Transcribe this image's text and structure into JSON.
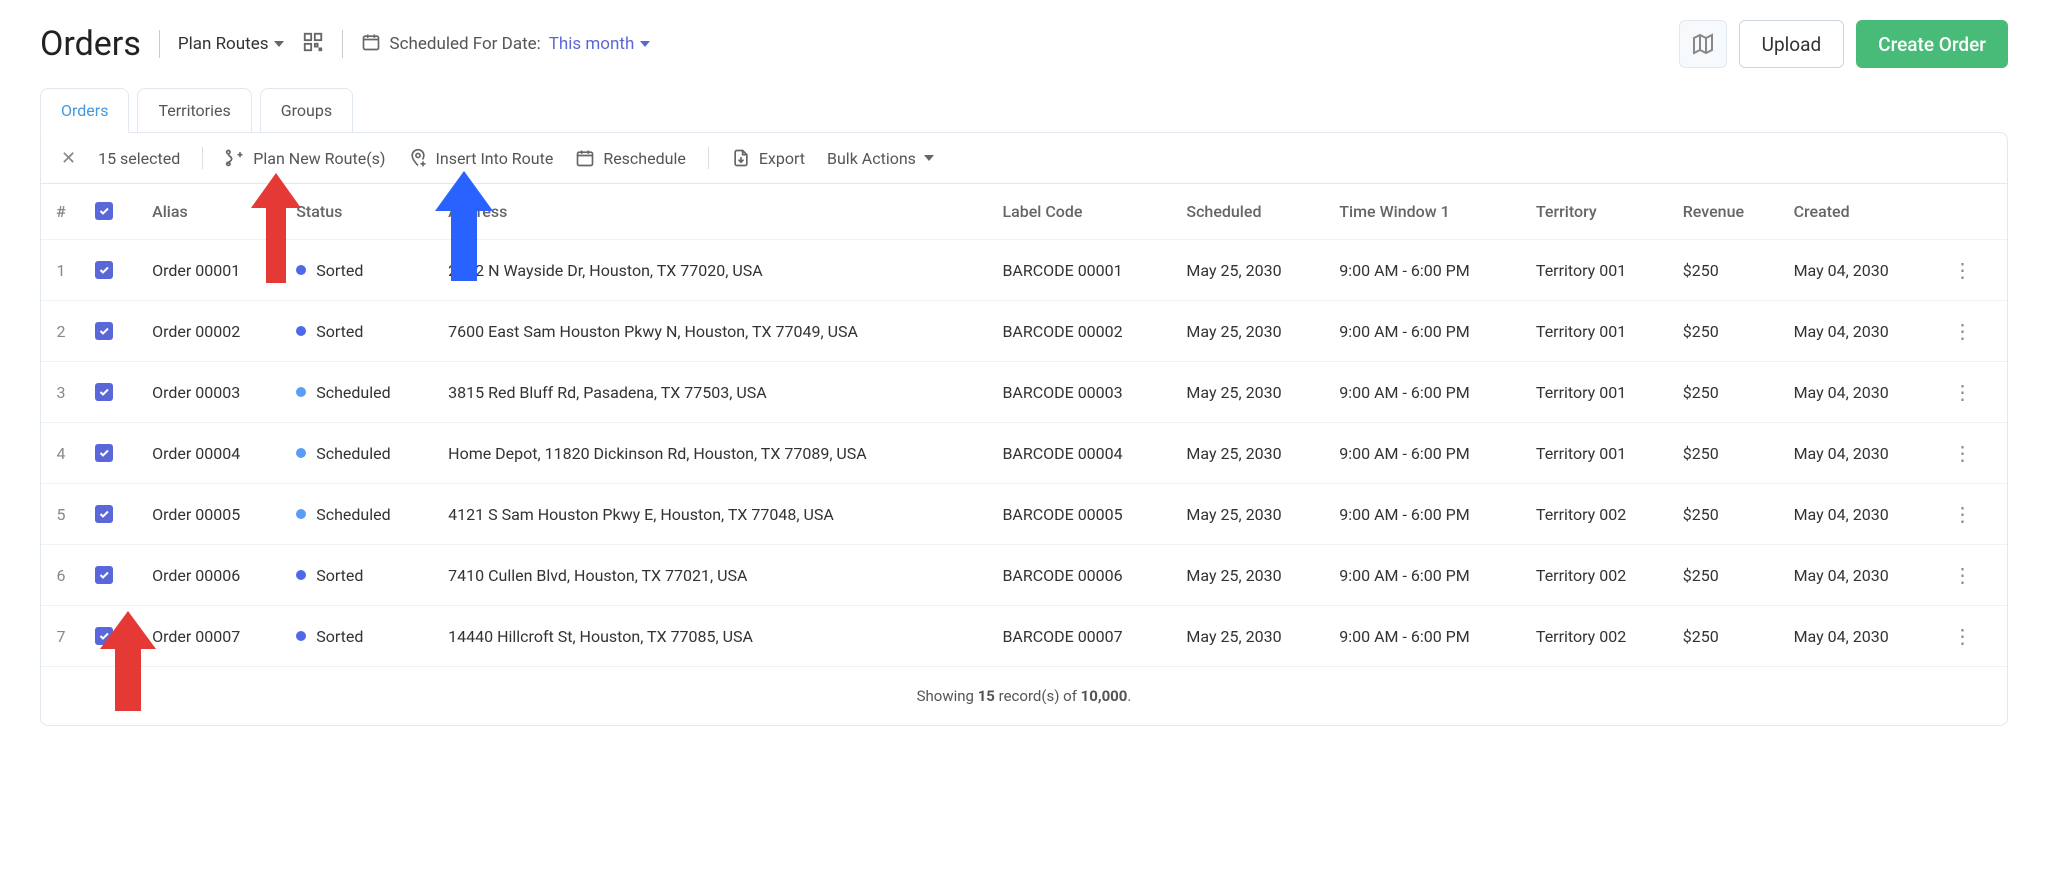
{
  "page_title": "Orders",
  "plan_routes_label": "Plan Routes",
  "scheduled_for_label": "Scheduled For Date:",
  "scheduled_for_value": "This month",
  "upload_label": "Upload",
  "create_order_label": "Create Order",
  "tabs": {
    "orders": "Orders",
    "territories": "Territories",
    "groups": "Groups"
  },
  "selection_count": "15 selected",
  "toolbar": {
    "plan_new": "Plan New Route(s)",
    "insert": "Insert Into Route",
    "reschedule": "Reschedule",
    "export": "Export",
    "bulk": "Bulk Actions"
  },
  "columns": {
    "num": "#",
    "alias": "Alias",
    "status": "Status",
    "address": "Address",
    "label_code": "Label Code",
    "scheduled": "Scheduled",
    "time_window": "Time Window 1",
    "territory": "Territory",
    "revenue": "Revenue",
    "created": "Created"
  },
  "status_labels": {
    "sorted": "Sorted",
    "scheduled": "Scheduled"
  },
  "rows": [
    {
      "n": "1",
      "alias": "Order 00001",
      "status": "sorted",
      "address": "2802 N Wayside Dr, Houston, TX 77020, USA",
      "label": "BARCODE 00001",
      "scheduled": "May 25, 2030",
      "tw": "9:00 AM - 6:00 PM",
      "territory": "Territory 001",
      "revenue": "$250",
      "created": "May 04, 2030"
    },
    {
      "n": "2",
      "alias": "Order 00002",
      "status": "sorted",
      "address": "7600 East Sam Houston Pkwy N, Houston, TX 77049, USA",
      "label": "BARCODE 00002",
      "scheduled": "May 25, 2030",
      "tw": "9:00 AM - 6:00 PM",
      "territory": "Territory 001",
      "revenue": "$250",
      "created": "May 04, 2030"
    },
    {
      "n": "3",
      "alias": "Order 00003",
      "status": "scheduled",
      "address": "3815 Red Bluff Rd, Pasadena, TX 77503, USA",
      "label": "BARCODE 00003",
      "scheduled": "May 25, 2030",
      "tw": "9:00 AM - 6:00 PM",
      "territory": "Territory 001",
      "revenue": "$250",
      "created": "May 04, 2030"
    },
    {
      "n": "4",
      "alias": "Order 00004",
      "status": "scheduled",
      "address": "Home Depot, 11820 Dickinson Rd, Houston, TX 77089, USA",
      "label": "BARCODE 00004",
      "scheduled": "May 25, 2030",
      "tw": "9:00 AM - 6:00 PM",
      "territory": "Territory 001",
      "revenue": "$250",
      "created": "May 04, 2030"
    },
    {
      "n": "5",
      "alias": "Order 00005",
      "status": "scheduled",
      "address": "4121 S Sam Houston Pkwy E, Houston, TX 77048, USA",
      "label": "BARCODE 00005",
      "scheduled": "May 25, 2030",
      "tw": "9:00 AM - 6:00 PM",
      "territory": "Territory 002",
      "revenue": "$250",
      "created": "May 04, 2030"
    },
    {
      "n": "6",
      "alias": "Order 00006",
      "status": "sorted",
      "address": "7410 Cullen Blvd, Houston, TX 77021, USA",
      "label": "BARCODE 00006",
      "scheduled": "May 25, 2030",
      "tw": "9:00 AM - 6:00 PM",
      "territory": "Territory 002",
      "revenue": "$250",
      "created": "May 04, 2030"
    },
    {
      "n": "7",
      "alias": "Order 00007",
      "status": "sorted",
      "address": "14440 Hillcroft St, Houston, TX 77085, USA",
      "label": "BARCODE 00007",
      "scheduled": "May 25, 2030",
      "tw": "9:00 AM - 6:00 PM",
      "territory": "Territory 002",
      "revenue": "$250",
      "created": "May 04, 2030"
    }
  ],
  "footer": {
    "prefix": "Showing ",
    "count": "15",
    "mid": " record(s) of ",
    "total": "10,000",
    "suffix": "."
  },
  "annotation_arrows": {
    "red1_color": "#e53935",
    "blue_color": "#2962ff"
  }
}
